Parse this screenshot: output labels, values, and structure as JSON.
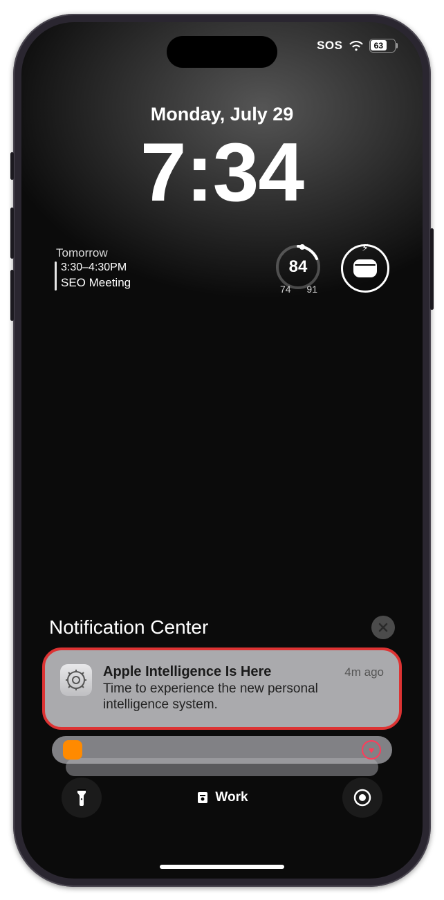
{
  "status": {
    "sos": "SOS",
    "battery_pct": "63"
  },
  "date": "Monday, July 29",
  "time": "7:34",
  "calendar": {
    "tomorrow": "Tomorrow",
    "time": "3:30–4:30PM",
    "title": "SEO Meeting"
  },
  "weather": {
    "current": "84",
    "low": "74",
    "high": "91"
  },
  "notification_center": {
    "title": "Notification Center"
  },
  "notification": {
    "title": "Apple Intelligence Is Here",
    "body": "Time to experience the new personal intelligence system.",
    "time": "4m ago"
  },
  "focus": {
    "label": "Work"
  }
}
